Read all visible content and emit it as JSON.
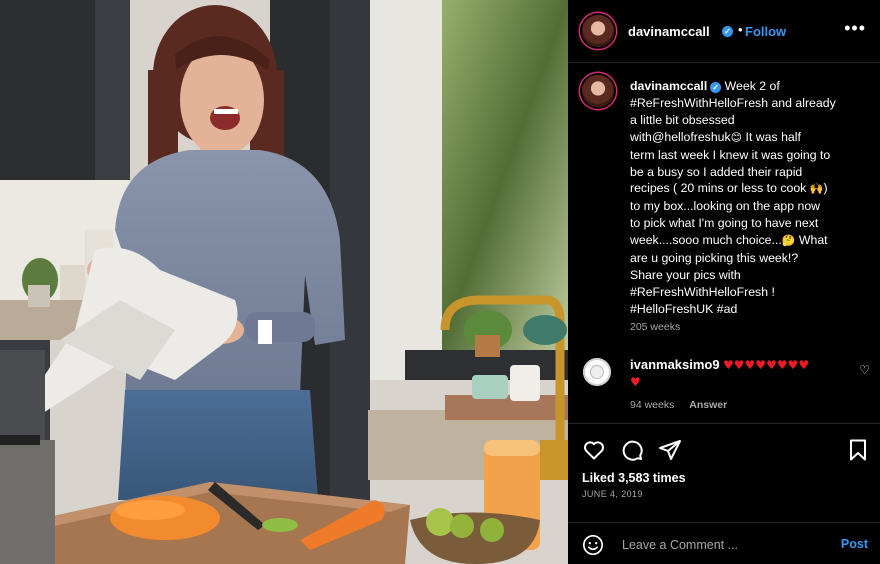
{
  "post": {
    "username": "davinamccall",
    "verified_glyph": "✓",
    "dot": "•",
    "follow_label": "Follow",
    "more_label": "•••",
    "caption": {
      "username": "davinamccall",
      "lines": [
        "Week 2 of",
        "#ReFreshWithHelloFresh and already",
        "a little bit obsessed",
        "with@hellofreshuk",
        " It was half",
        "term last week I knew it was going to",
        "be a busy so I added their rapid",
        "recipes ( 20 mins or less to cook ",
        ")",
        "to my box...looking on the app now",
        "to pick what I'm going to have next",
        "week....sooo much choice...",
        " What",
        "are u going picking this week!?",
        "Share your pics with",
        "#ReFreshWithHelloFresh !",
        "#HelloFreshUK #ad"
      ],
      "emoji_1": "😊",
      "emoji_2": "🙌",
      "emoji_3": "🤔",
      "time": "205 weeks"
    },
    "comment": {
      "username": "ivanmaksimo9",
      "hearts_line1": "♥♥♥♥♥♥♥♥",
      "hearts_line2": "♥",
      "like_glyph": "♡",
      "time": "94 weeks",
      "answer_label": "Answer"
    },
    "likes_text": "Liked 3,583 times",
    "date_text": "JUNE 4, 2019",
    "composer": {
      "placeholder": "Leave a Comment ...",
      "post_label": "Post"
    }
  },
  "icons": [
    "heart-icon",
    "comment-icon",
    "share-icon",
    "bookmark-icon",
    "smiley-icon",
    "more-icon",
    "verified-icon"
  ],
  "colors": {
    "background": "#000000",
    "link_blue": "#3897f0",
    "muted": "#a8a8a8",
    "heart_red": "#ed1c24",
    "divider": "#262626"
  }
}
